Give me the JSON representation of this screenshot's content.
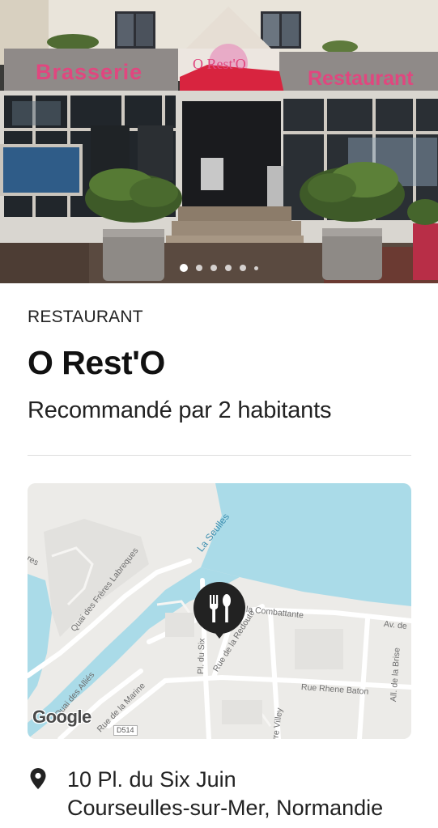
{
  "hero": {
    "sign_left": "Brasserie",
    "sign_center": "O Rest'O",
    "sign_right": "Restaurant",
    "carousel": {
      "count": 6,
      "active_index": 0
    }
  },
  "place": {
    "category": "RESTAURANT",
    "name": "O Rest'O",
    "recommendation": "Recommandé par 2 habitants"
  },
  "map": {
    "labels": {
      "river": "La Seulles",
      "quai_freres": "Quai des Frères Labreques",
      "quai_allies": "Quai des Alliés",
      "rue_marine": "Rue de la Marine",
      "rue_redoute": "Rue de la Redoute",
      "place_six": "Pl. du Six",
      "combattante": "la Combattante",
      "avenue": "Av. de",
      "rue_rhene": "Rue Rhene Baton",
      "brise": "All. de la Brise",
      "pierre_villey": "rre Villey",
      "top_left": "res",
      "road_shield": "D514"
    },
    "attribution": "Google",
    "marker_icon": "fork-knife-icon"
  },
  "address": {
    "icon": "location-pin-icon",
    "line1": "10 Pl. du Six Juin",
    "line2": "Courseulles-sur-Mer, Normandie"
  },
  "colors": {
    "sign_pink": "#e0477f",
    "awning_red": "#d8243f",
    "water": "#aadbe8",
    "map_land": "#ecebe8",
    "marker": "#222222"
  }
}
